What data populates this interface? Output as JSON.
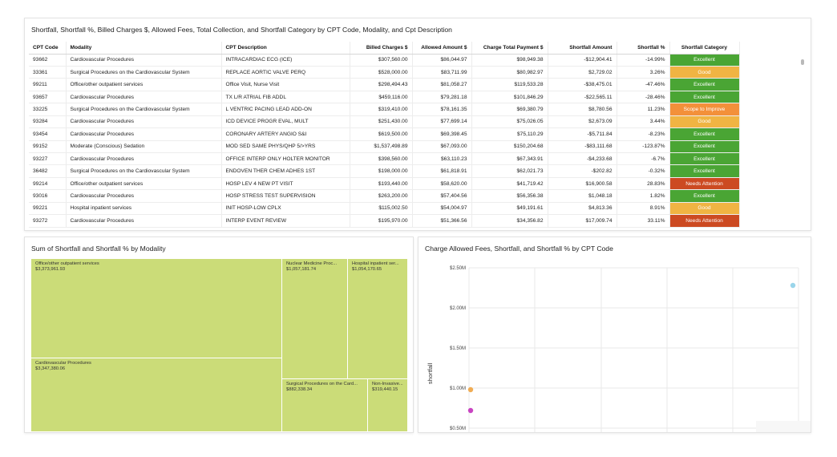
{
  "table_panel": {
    "title": "Shortfall, Shortfall %, Billed Charges $, Allowed Fees, Total Collection, and Shortfall Category by CPT Code, Modality, and Cpt Description",
    "columns": [
      "CPT Code",
      "Modality",
      "CPT Description",
      "Billed Charges $",
      "Allowed Amount $",
      "Charge Total Payment $",
      "Shortfall Amount",
      "Shortfall %",
      "Shortfall Category"
    ],
    "rows": [
      [
        "93662",
        "Cardiovascular Procedures",
        "INTRACARDIAC ECG (ICE)",
        "$307,560.00",
        "$86,044.97",
        "$98,949.38",
        "-$12,904.41",
        "-14.99%",
        "Excellent"
      ],
      [
        "33361",
        "Surgical Procedures on the Cardiovascular System",
        "REPLACE AORTIC VALVE PERQ",
        "$528,000.00",
        "$83,711.99",
        "$80,982.97",
        "$2,729.02",
        "3.26%",
        "Good"
      ],
      [
        "99211",
        " Office/other outpatient services",
        "Office Visit, Nurse Visit",
        "$298,494.43",
        "$81,058.27",
        "$119,533.28",
        "-$38,475.01",
        "-47.46%",
        "Excellent"
      ],
      [
        "93657",
        "Cardiovascular Procedures",
        "TX L/R ATRIAL FIB ADDL",
        "$459,116.00",
        "$79,281.18",
        "$101,846.29",
        "-$22,565.11",
        "-28.46%",
        "Excellent"
      ],
      [
        "33225",
        "Surgical Procedures on the Cardiovascular System",
        "L VENTRIC PACING LEAD ADD-ON",
        "$319,410.00",
        "$78,161.35",
        "$69,380.79",
        "$8,780.56",
        "11.23%",
        "Scope to Improve"
      ],
      [
        "93284",
        "Cardiovascular Procedures",
        "ICD DEVICE PROGR EVAL, MULT",
        "$251,430.00",
        "$77,699.14",
        "$75,026.05",
        "$2,673.09",
        "3.44%",
        "Good"
      ],
      [
        "93454",
        "Cardiovascular Procedures",
        "CORONARY ARTERY ANGIO S&I",
        "$619,500.00",
        "$69,398.45",
        "$75,110.29",
        "-$5,711.84",
        "-8.23%",
        "Excellent"
      ],
      [
        "99152",
        "Moderate (Conscious) Sedation",
        "MOD SED SAME PHYS/QHP 5/>YRS",
        "$1,537,498.89",
        "$67,093.00",
        "$150,204.68",
        "-$83,111.68",
        "-123.87%",
        "Excellent"
      ],
      [
        "93227",
        "Cardiovascular Procedures",
        "OFFICE INTERP ONLY HOLTER MONITOR",
        "$398,560.00",
        "$63,110.23",
        "$67,343.91",
        "-$4,233.68",
        "-6.7%",
        "Excellent"
      ],
      [
        "36482",
        "Surgical Procedures on the Cardiovascular System",
        "ENDOVEN THER CHEM ADHES 1ST",
        "$198,000.00",
        "$61,818.91",
        "$62,021.73",
        "-$202.82",
        "-0.32%",
        "Excellent"
      ],
      [
        "99214",
        " Office/other outpatient services",
        "HOSP LEV 4 NEW PT VISIT",
        "$193,440.00",
        "$58,620.00",
        "$41,719.42",
        "$16,900.58",
        "28.83%",
        "Needs Attention"
      ],
      [
        "93016",
        "Cardiovascular Procedures",
        "HOSP STRESS TEST SUPERVISION",
        "$263,200.00",
        "$57,404.56",
        "$56,356.38",
        "$1,048.18",
        "1.82%",
        "Excellent"
      ],
      [
        "99221",
        "Hospital inpatient services",
        "INIT HOSP-LOW CPLX",
        "$115,002.50",
        "$54,004.97",
        "$49,191.61",
        "$4,813.36",
        "8.91%",
        "Good"
      ],
      [
        "93272",
        "Cardiovascular Procedures",
        "INTERP EVENT REVIEW",
        "$195,970.00",
        "$51,366.56",
        "$34,356.82",
        "$17,009.74",
        "33.11%",
        "Needs Attention"
      ]
    ],
    "category_colors": {
      "Excellent": "#4aa534",
      "Good": "#f0b443",
      "Scope to Improve": "#f3903a",
      "Needs Attention": "#cc4a22"
    }
  },
  "treemap_panel": {
    "title": "Sum of Shortfall and Shortfall % by Modality",
    "fill_color": "#cbdc78",
    "cells": [
      {
        "label": "Office/other outpatient services",
        "value": "$3,373,961.93"
      },
      {
        "label": "Cardiovascular Procedures",
        "value": "$3,347,380.06"
      },
      {
        "label": "Nuclear Medicine Proc...",
        "value": "$1,057,181.74"
      },
      {
        "label": "Hospital inpatient ser...",
        "value": "$1,054,170.65"
      },
      {
        "label": "Surgical Procedures on the Card...",
        "value": "$882,338.34"
      },
      {
        "label": "Non-Invasive...",
        "value": "$319,440.15"
      }
    ]
  },
  "scatter_panel": {
    "title": "Charge Allowed Fees, Shortfall, and Shortfall % by CPT Code",
    "ylabel": "shortfall",
    "y_ticks": [
      "$2.50M",
      "$2.00M",
      "$1.50M",
      "$1.00M",
      "$0.50M"
    ]
  },
  "chart_data": {
    "type": "scatter",
    "title": "Charge Allowed Fees, Shortfall, and Shortfall % by CPT Code",
    "xlabel": "",
    "ylabel": "shortfall",
    "ylim": [
      0.5,
      2.5
    ],
    "y_unit": "$M",
    "grid": true,
    "points": [
      {
        "y": 2.28,
        "color": "#9ad5ea",
        "x_frac": 1.0
      },
      {
        "y": 0.98,
        "color": "#f0ac54",
        "x_frac": 0.0
      },
      {
        "y": 0.72,
        "color": "#c944c2",
        "x_frac": 0.0
      }
    ]
  }
}
